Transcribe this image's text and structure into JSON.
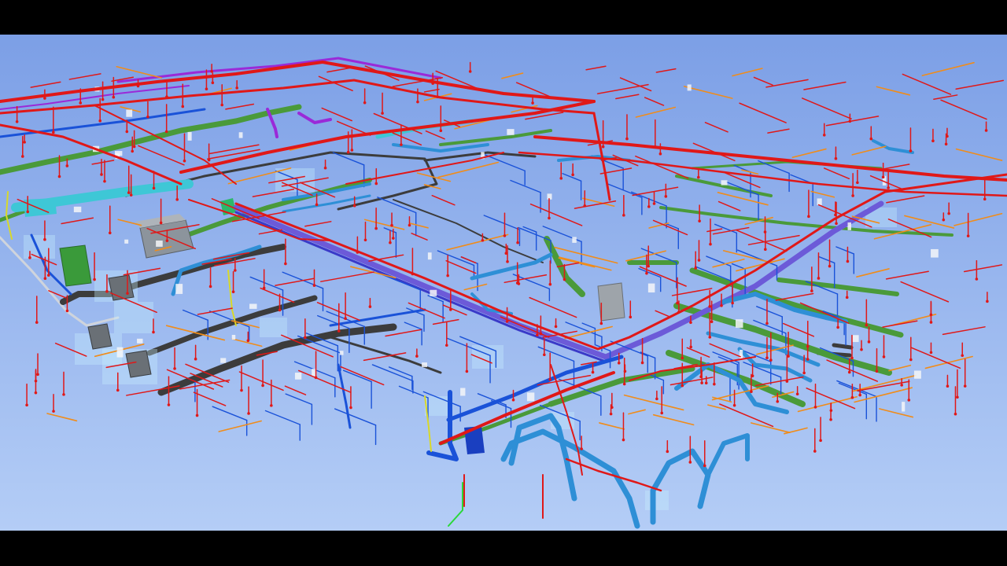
{
  "colors": {
    "background_top": "#7c9fe6",
    "background_bottom": "#b4cdf6",
    "fire_sprinkler_pipe": "#e01818",
    "domestic_water_pipe": "#1a52d8",
    "cable_tray": "#3c3c3c",
    "hvac_duct_green": "#4a9a3a",
    "chilled_water_pipe": "#2e8fd6",
    "cyan_duct": "#3ec7d6",
    "purple_pipe": "#9a2ad8",
    "orange_pipe": "#f08c1a",
    "yellow_pipe": "#d8d82a",
    "equipment_gray": "#8c949c",
    "equipment_green": "#3a9a3a"
  },
  "model": {
    "view": "perspective-3d",
    "systems": [
      "fire-sprinkler",
      "domestic-water",
      "hvac-duct",
      "chilled-water",
      "cable-tray",
      "gas"
    ]
  }
}
